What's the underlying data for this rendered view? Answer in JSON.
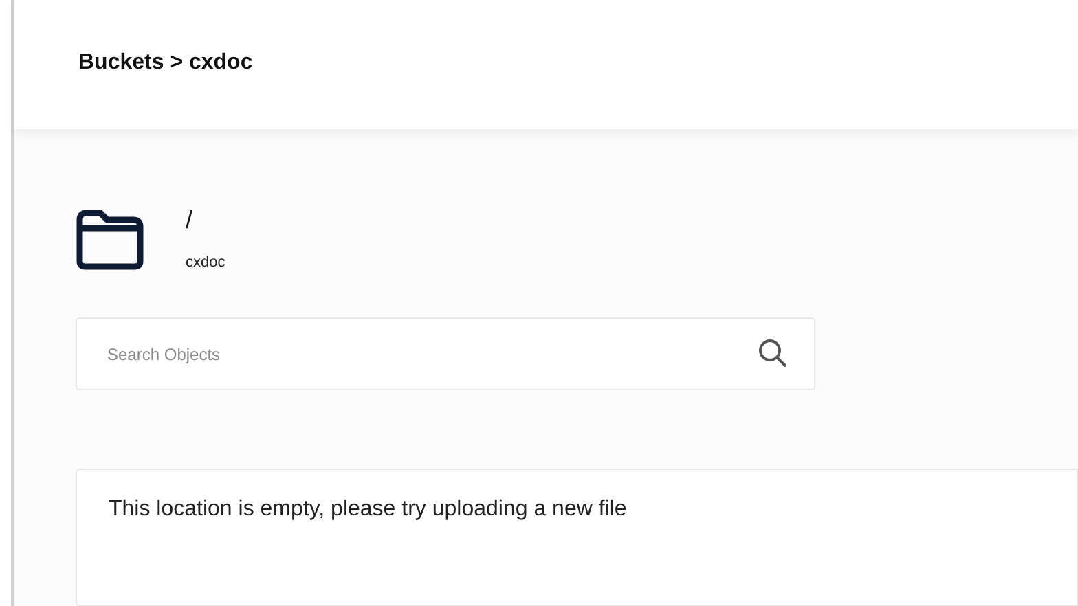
{
  "breadcrumb": "Buckets > cxdoc",
  "location": {
    "path": "/",
    "bucket": "cxdoc"
  },
  "search": {
    "placeholder": "Search Objects"
  },
  "empty_message": "This location is empty, please try uploading a new file"
}
